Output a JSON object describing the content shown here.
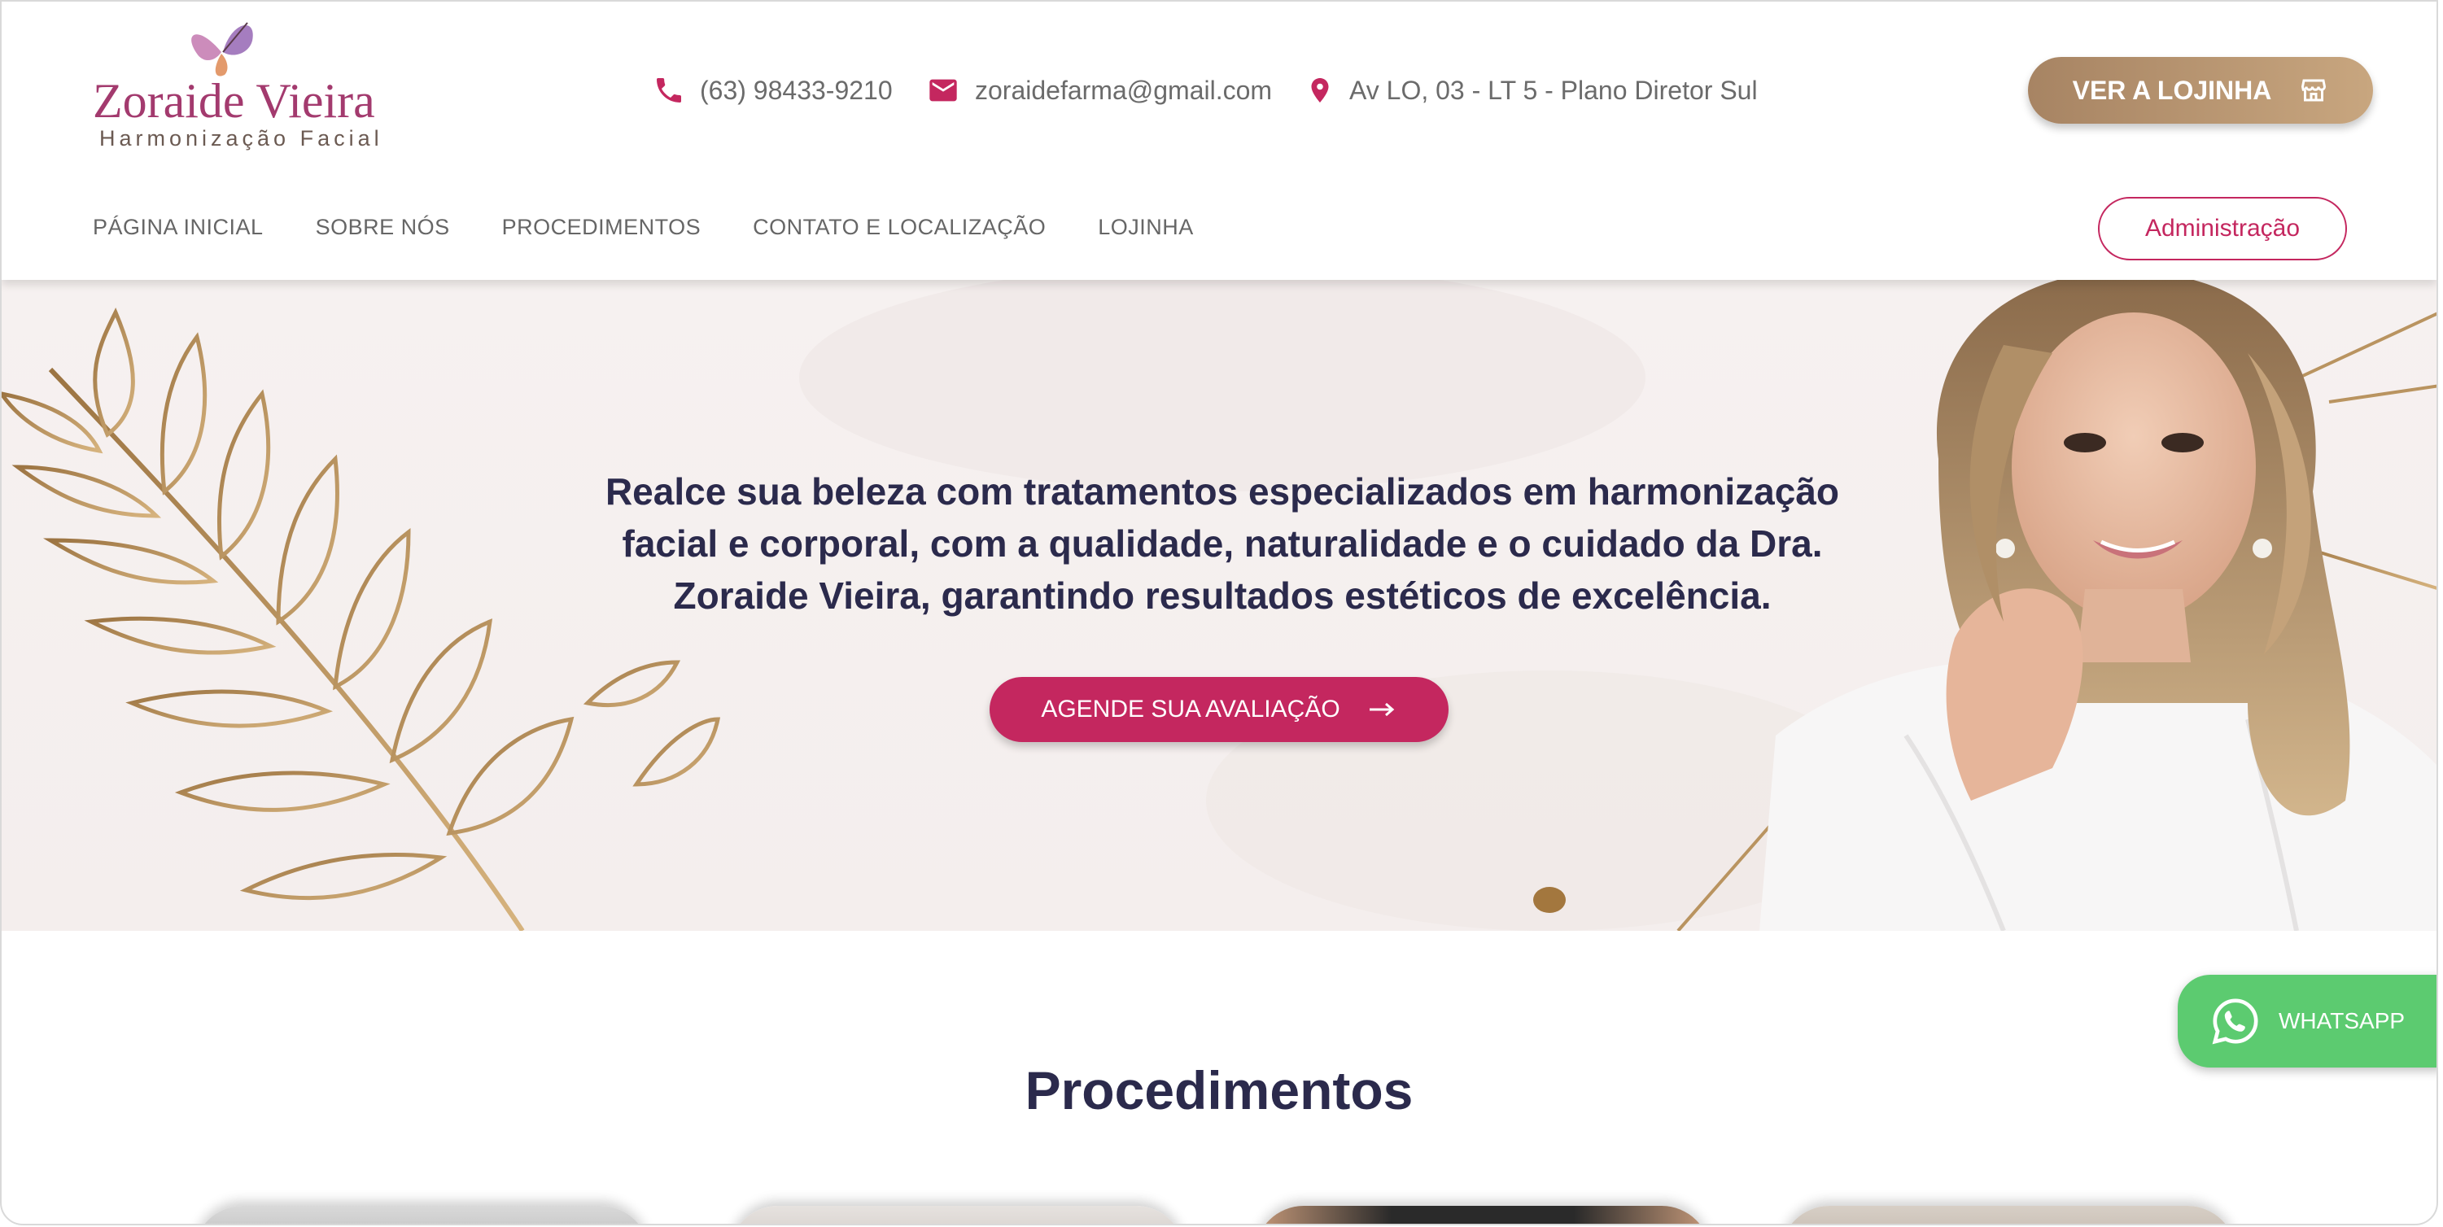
{
  "brand": {
    "name": "Zoraide Vieira",
    "tagline": "Harmonização Facial"
  },
  "header": {
    "phone": "(63) 98433-9210",
    "email": "zoraidefarma@gmail.com",
    "address": "Av LO, 03 - LT 5 - Plano Diretor Sul",
    "store_button": "VER A LOJINHA",
    "admin_button": "Administração"
  },
  "nav": {
    "items": [
      {
        "label": "PÁGINA INICIAL"
      },
      {
        "label": "SOBRE NÓS"
      },
      {
        "label": "PROCEDIMENTOS"
      },
      {
        "label": "CONTATO E LOCALIZAÇÃO"
      },
      {
        "label": "LOJINHA"
      }
    ]
  },
  "hero": {
    "headline": "Realce sua beleza com tratamentos especializados em harmonização facial e corporal, com a qualidade, naturalidade e o cuidado da Dra. Zoraide Vieira, garantindo resultados estéticos de excelência.",
    "cta": "AGENDE SUA AVALIAÇÃO"
  },
  "section": {
    "title": "Procedimentos"
  },
  "whatsapp": {
    "label": "WHATSAPP"
  },
  "colors": {
    "primary": "#c4275f",
    "gold": "#b48f6a",
    "heading": "#2b2a4c",
    "whatsapp": "#5ccb70"
  },
  "icons": [
    "phone-icon",
    "mail-icon",
    "location-pin-icon",
    "store-icon",
    "arrow-right-icon",
    "whatsapp-icon",
    "butterfly-logo-icon"
  ]
}
